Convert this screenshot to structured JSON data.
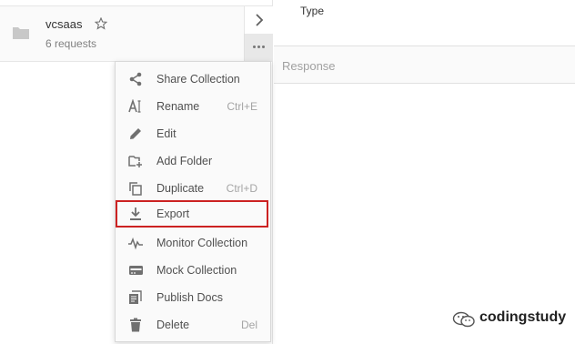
{
  "collection": {
    "name": "vcsaas",
    "requests": "6 requests"
  },
  "right_pane": {
    "type_label": "Type",
    "response_label": "Response"
  },
  "menu": {
    "items": [
      {
        "label": "Share Collection",
        "shortcut": "",
        "icon": "share-icon"
      },
      {
        "label": "Rename",
        "shortcut": "Ctrl+E",
        "icon": "rename-icon"
      },
      {
        "label": "Edit",
        "shortcut": "",
        "icon": "pencil-icon"
      },
      {
        "label": "Add Folder",
        "shortcut": "",
        "icon": "add-folder-icon"
      },
      {
        "label": "Duplicate",
        "shortcut": "Ctrl+D",
        "icon": "duplicate-icon"
      },
      {
        "label": "Export",
        "shortcut": "",
        "icon": "download-icon",
        "highlighted": true
      },
      {
        "label": "Monitor Collection",
        "shortcut": "",
        "icon": "pulse-icon"
      },
      {
        "label": "Mock Collection",
        "shortcut": "",
        "icon": "server-icon"
      },
      {
        "label": "Publish Docs",
        "shortcut": "",
        "icon": "docs-icon"
      },
      {
        "label": "Delete",
        "shortcut": "Del",
        "icon": "trash-icon"
      }
    ]
  },
  "watermark": {
    "text": "codingstudy"
  },
  "colors": {
    "highlight_border": "#cc2222",
    "menu_bg": "#fafafa",
    "icon": "#707070"
  }
}
